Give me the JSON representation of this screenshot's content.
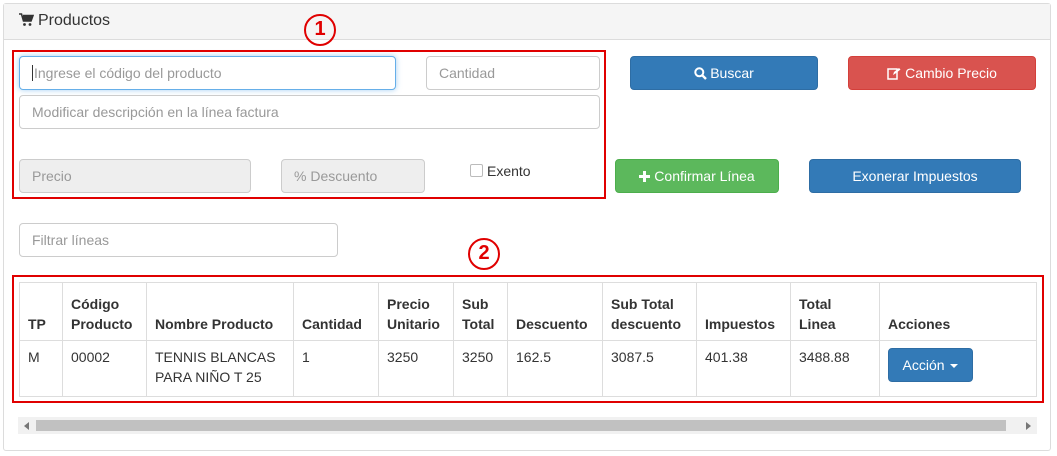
{
  "panel": {
    "title": "Productos"
  },
  "form": {
    "codigo_placeholder": "Ingrese el código del producto",
    "cantidad_placeholder": "Cantidad",
    "descripcion_placeholder": "Modificar descripción en la línea factura",
    "precio_placeholder": "Precio",
    "descuento_placeholder": "% Descuento",
    "exento_label": "Exento",
    "filtrar_placeholder": "Filtrar líneas"
  },
  "buttons": {
    "buscar": "Buscar",
    "cambio_precio": "Cambio Precio",
    "confirmar_linea": "Confirmar Línea",
    "exonerar": "Exonerar Impuestos",
    "accion": "Acción"
  },
  "annotations": {
    "one": "1",
    "two": "2"
  },
  "table": {
    "headers": [
      "TP",
      "Código Producto",
      "Nombre Producto",
      "Cantidad",
      "Precio Unitario",
      "Sub Total",
      "Descuento",
      "Sub Total descuento",
      "Impuestos",
      "Total Linea",
      "Acciones"
    ],
    "rows": [
      [
        "M",
        "00002",
        "TENNIS BLANCAS PARA NIÑO T 25",
        "1",
        "3250",
        "3250",
        "162.5",
        "3087.5",
        "401.38",
        "3488.88"
      ]
    ]
  },
  "colors": {
    "primary": "#337ab7",
    "danger": "#d9534f",
    "success": "#5cb85c",
    "annotation": "#e00000"
  }
}
